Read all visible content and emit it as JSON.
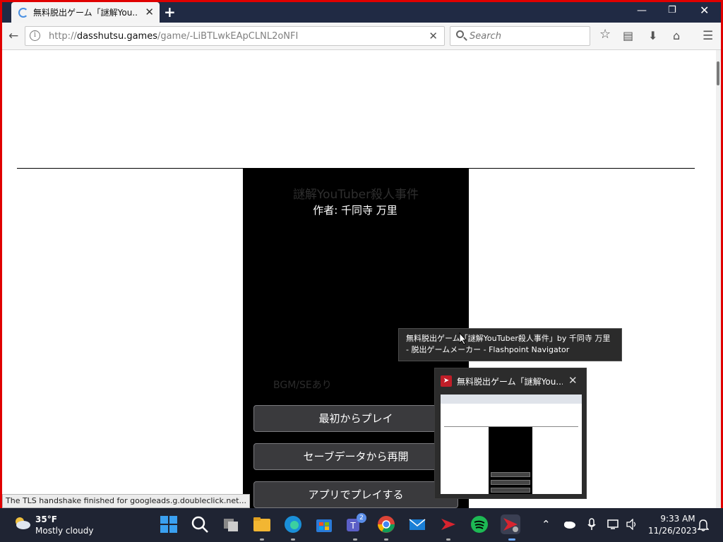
{
  "browser": {
    "tab_title": "無料脱出ゲーム「謎解You...",
    "url_prefix": "http://",
    "url_host": "dasshutsu.games",
    "url_path": "/game/-LiBTLwkEApCLNL2oNFI",
    "search_placeholder": "Search",
    "status_text": "The TLS handshake finished for googleads.g.doubleclick.net..."
  },
  "game": {
    "title": "謎解YouTuber殺人事件",
    "author": "作者: 千同寺 万里",
    "bgm_note": "BGM/SEあり",
    "buttons": [
      "最初からプレイ",
      "セーブデータから再開",
      "アプリでプレイする"
    ]
  },
  "tooltip": {
    "line1": "無料脱出ゲーム「謎解YouTuber殺人事件」by 千同寺 万里",
    "line2": "- 脱出ゲームメーカー - Flashpoint Navigator"
  },
  "thumbnail": {
    "title": "無料脱出ゲーム「謎解You..."
  },
  "taskbar": {
    "temperature": "35°F",
    "weather": "Mostly cloudy",
    "time": "9:33 AM",
    "date": "11/26/2023",
    "teams_badge": "2"
  },
  "colors": {
    "window_border": "#e00000",
    "titlebar": "#202a44",
    "taskbar": "#1f2433",
    "game_bg": "#000000"
  }
}
